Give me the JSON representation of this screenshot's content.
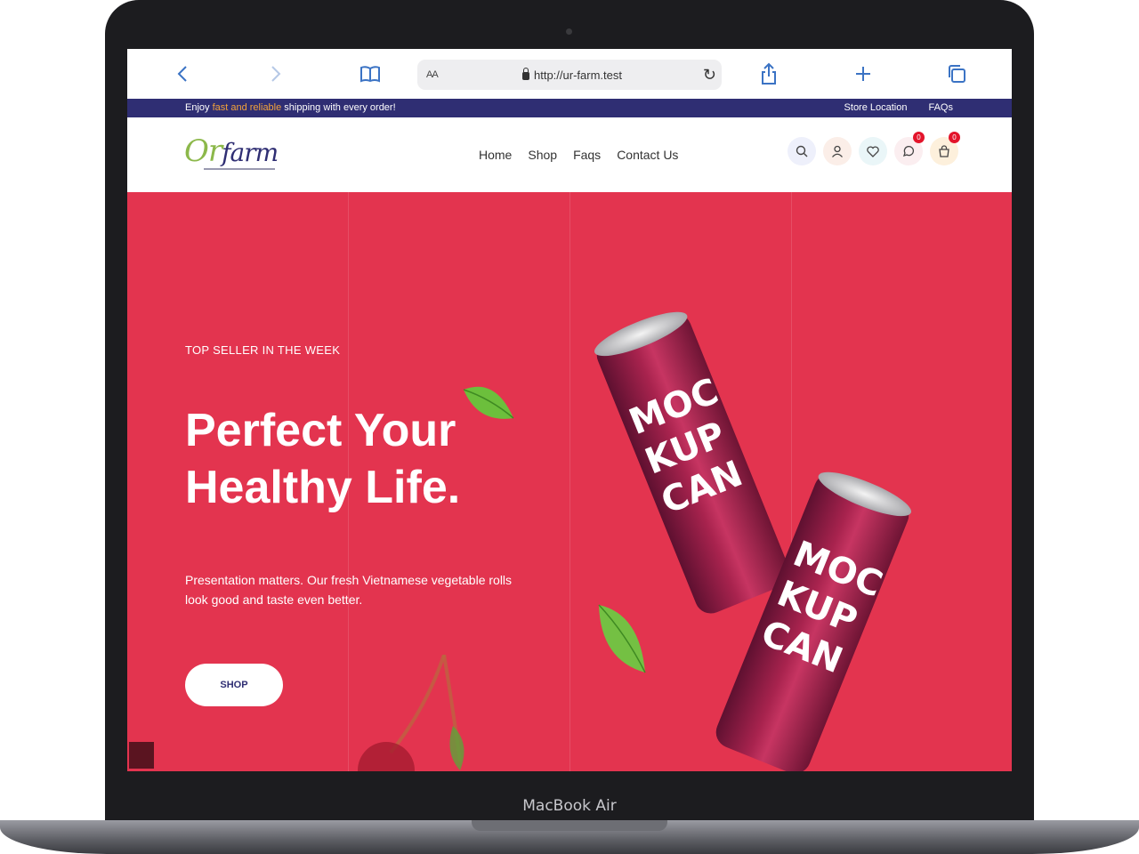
{
  "device": {
    "brand_label": "MacBook Air"
  },
  "browser": {
    "text_size_label": "AA",
    "url": "http://ur-farm.test"
  },
  "announcement": {
    "text_before": "Enjoy ",
    "text_highlight": "fast and reliable",
    "text_after": " shipping with every order!",
    "links": [
      "Store Location",
      "FAQs"
    ]
  },
  "header": {
    "logo_text_first": "Or",
    "logo_text_rest": "farm",
    "nav": [
      "Home",
      "Shop",
      "Faqs",
      "Contact Us"
    ],
    "compare_count": "0",
    "cart_count": "0"
  },
  "hero": {
    "eyebrow": "TOP SELLER IN THE WEEK",
    "title": "Perfect Your Healthy Life.",
    "description": "Presentation matters. Our fresh Vietnamese vegetable rolls look good and taste even better.",
    "cta_label": "SHOP",
    "can_text_1": "MOC KUP CAN",
    "can_text_2": "MOC KUP CAN"
  },
  "colors": {
    "hero_bg": "#e3344f",
    "announce_bg": "#2f2e73",
    "accent_orange": "#f2a23a",
    "badge_red": "#e3142b",
    "browser_blue": "#3b73c4"
  }
}
